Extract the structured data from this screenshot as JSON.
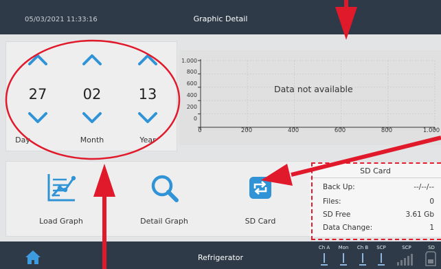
{
  "header": {
    "datetime": "05/03/2021 11:33:16",
    "title": "Graphic Detail"
  },
  "date_selector": {
    "day": {
      "value": "27",
      "label": "Day"
    },
    "month": {
      "value": "02",
      "label": "Month"
    },
    "year": {
      "value": "13",
      "label": "Year"
    }
  },
  "graph": {
    "message": "Data not available",
    "y_ticks": [
      "1.000",
      "800",
      "600",
      "400",
      "200",
      "0"
    ],
    "x_ticks": [
      "0",
      "200",
      "400",
      "600",
      "800",
      "1.000"
    ]
  },
  "chart_data": {
    "type": "line",
    "series": [],
    "x_ticks": [
      0,
      200,
      400,
      600,
      800,
      1000
    ],
    "y_ticks": [
      0,
      200,
      400,
      600,
      800,
      1000
    ],
    "xlim": [
      0,
      1000
    ],
    "ylim": [
      0,
      1000
    ],
    "grid": true,
    "annotation": "Data not available"
  },
  "tools": {
    "load_graph": "Load Graph",
    "detail_graph": "Detail Graph",
    "sd_card": "SD Card"
  },
  "sd_info": {
    "title": "SD Card",
    "rows": [
      {
        "label": "Back Up:",
        "value": "--/--/--"
      },
      {
        "label": "Files:",
        "value": "0"
      },
      {
        "label": "SD Free",
        "value": "3.61 Gb"
      },
      {
        "label": "Data Change:",
        "value": "1"
      }
    ]
  },
  "footer": {
    "device_name": "Refrigerator",
    "status": [
      "Ch A",
      "Mon",
      "Ch B",
      "SCP",
      "SCP",
      "SD"
    ]
  },
  "colors": {
    "accent": "#2f93d6",
    "bar": "#2e3a47",
    "annotation": "#e0192b"
  }
}
